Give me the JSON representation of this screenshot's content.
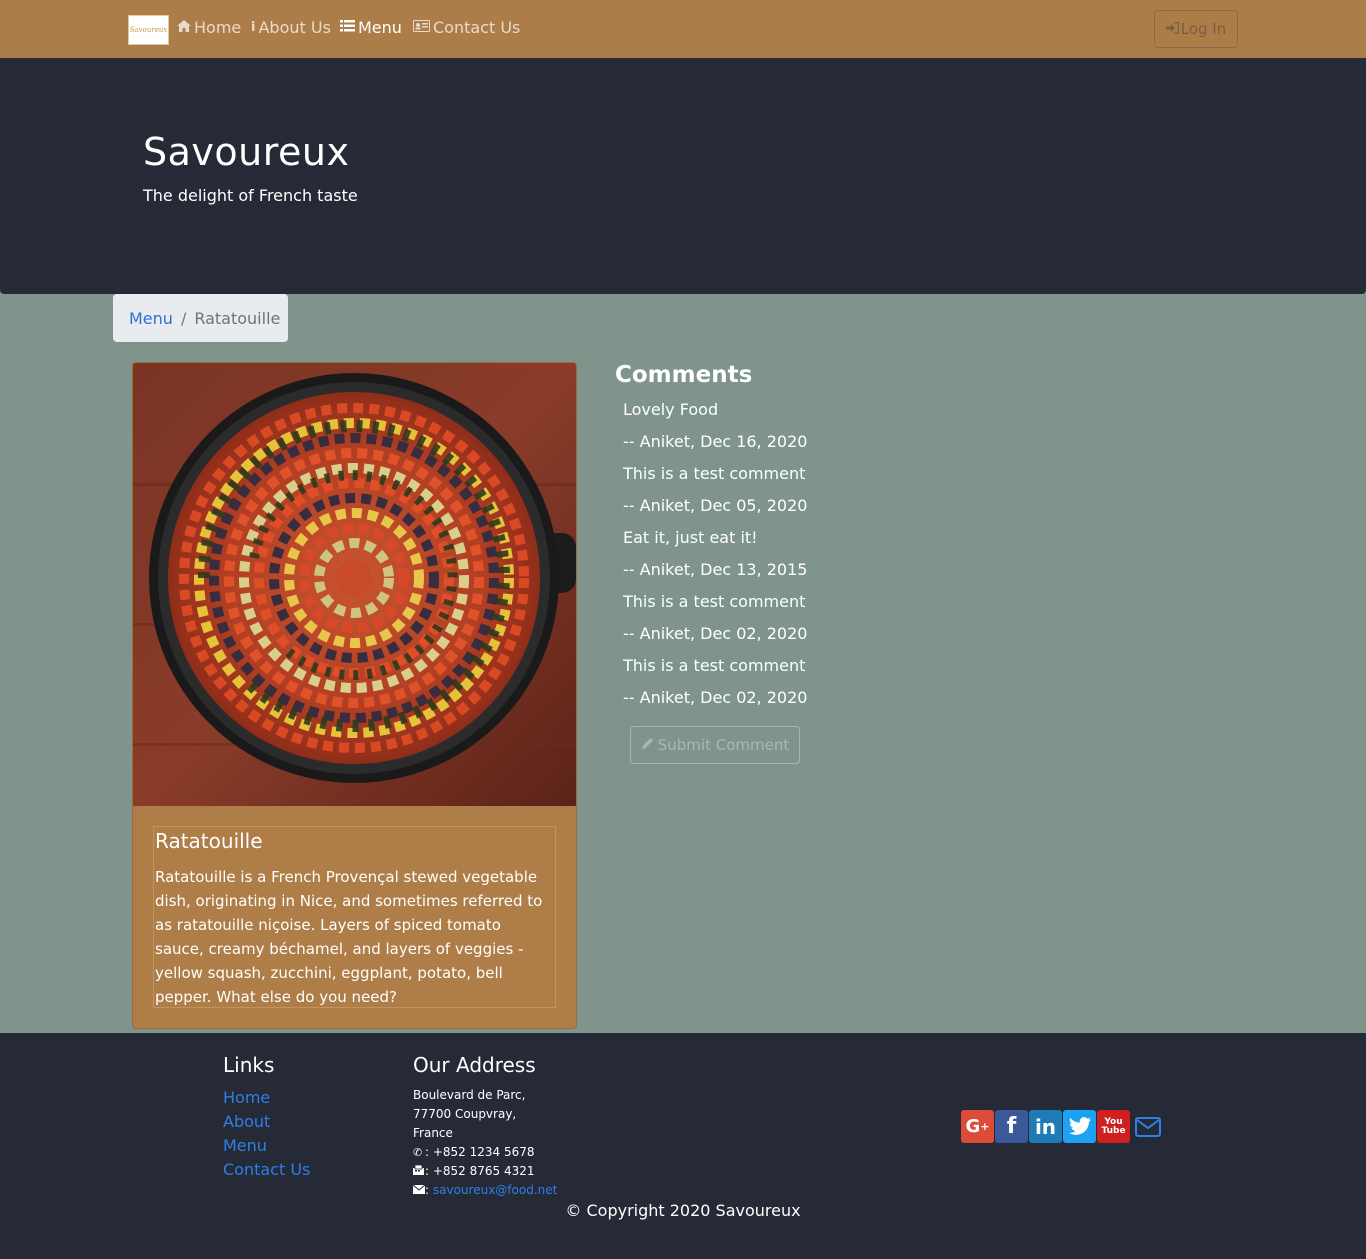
{
  "navbar": {
    "brand": "Savoureux",
    "links": [
      {
        "label": "Home",
        "icon": "home-icon"
      },
      {
        "label": "About Us",
        "icon": "info-icon"
      },
      {
        "label": "Menu",
        "icon": "list-icon",
        "active": true
      },
      {
        "label": "Contact Us",
        "icon": "address-card-icon"
      }
    ],
    "login_label": "Log In",
    "bg_color": "#ad7d49"
  },
  "jumbotron": {
    "title": "Savoureux",
    "subtitle": "The delight of French taste",
    "bg_color": "#252a36"
  },
  "breadcrumb": {
    "link": "Menu",
    "separator": "/",
    "active": "Ratatouille"
  },
  "dish": {
    "name": "Ratatouille",
    "description": "Ratatouille is a French Provençal stewed vegetable dish, originating in Nice, and sometimes referred to as ratatouille niçoise. Layers of spiced tomato sauce, creamy béchamel, and layers of veggies - yellow squash, zucchini, eggplant, potato, bell pepper. What else do you need?"
  },
  "comments": {
    "title": "Comments",
    "items": [
      {
        "text": "Lovely Food",
        "byline": "-- Aniket, Dec 16, 2020"
      },
      {
        "text": "This is a test comment",
        "byline": "-- Aniket, Dec 05, 2020"
      },
      {
        "text": "Eat it, just eat it!",
        "byline": "-- Aniket, Dec 13, 2015"
      },
      {
        "text": "This is a test comment",
        "byline": "-- Aniket, Dec 02, 2020"
      },
      {
        "text": "This is a test comment",
        "byline": "-- Aniket, Dec 02, 2020"
      }
    ],
    "submit_label": "Submit Comment"
  },
  "footer": {
    "links_title": "Links",
    "links": [
      "Home",
      "About",
      "Menu",
      "Contact Us"
    ],
    "address_title": "Our Address",
    "address_lines": [
      "Boulevard de Parc,",
      "77700 Coupvray,",
      "France"
    ],
    "phone": ": +852 1234 5678",
    "fax": ": +852 8765 4321",
    "email_prefix": ":",
    "email": "savoureux@food.net",
    "social": [
      "google-plus-icon",
      "facebook-icon",
      "linkedin-icon",
      "twitter-icon",
      "youtube-icon",
      "envelope-icon"
    ],
    "copyright": "© Copyright 2020 Savoureux"
  },
  "colors": {
    "page_bg": "#7f958c",
    "card_bg": "#ae7d48",
    "link": "#2f7fe6"
  }
}
